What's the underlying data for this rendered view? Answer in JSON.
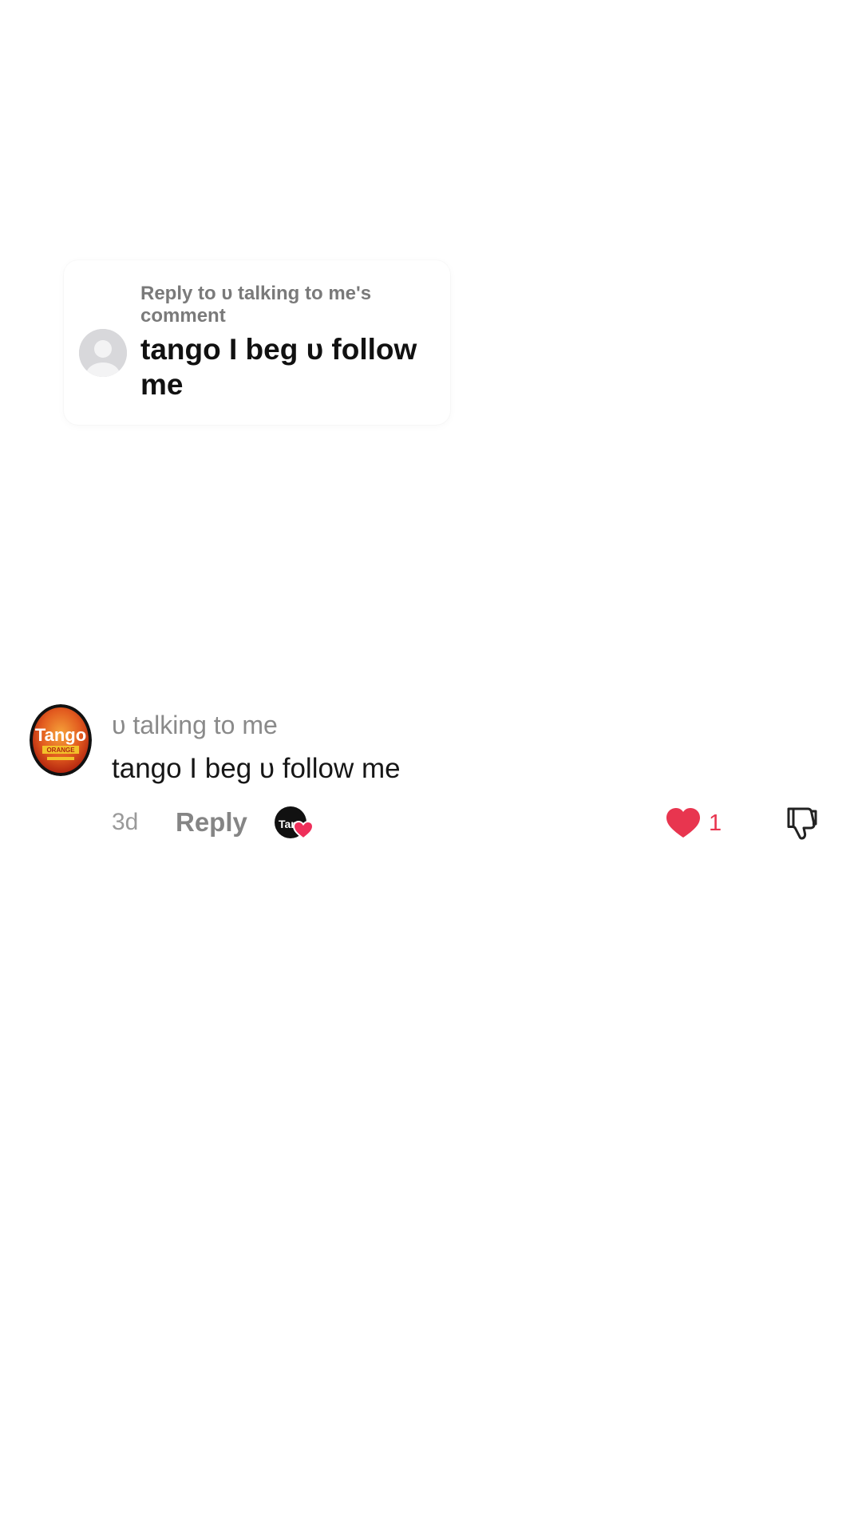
{
  "reply_card": {
    "heading": "Reply to υ talking to me's comment",
    "text": "tango I beg υ follow me",
    "avatar_icon": "default-user-avatar-icon"
  },
  "comment": {
    "username": "υ talking to me",
    "text": "tango I beg υ follow me",
    "age": "3d",
    "reply_label": "Reply",
    "creator_liked_icon": "creator-liked-heart-icon",
    "like_count": "1",
    "like_icon": "heart-filled-icon",
    "dislike_icon": "thumbs-down-icon",
    "avatar_logo_text": "Tango",
    "avatar_logo_subtext": "ORANGE",
    "creator_badge_text": "Tan"
  },
  "colors": {
    "like_red": "#e8354f",
    "tango_orange": "#e25b1f",
    "username_gray": "#8a8a8a"
  }
}
